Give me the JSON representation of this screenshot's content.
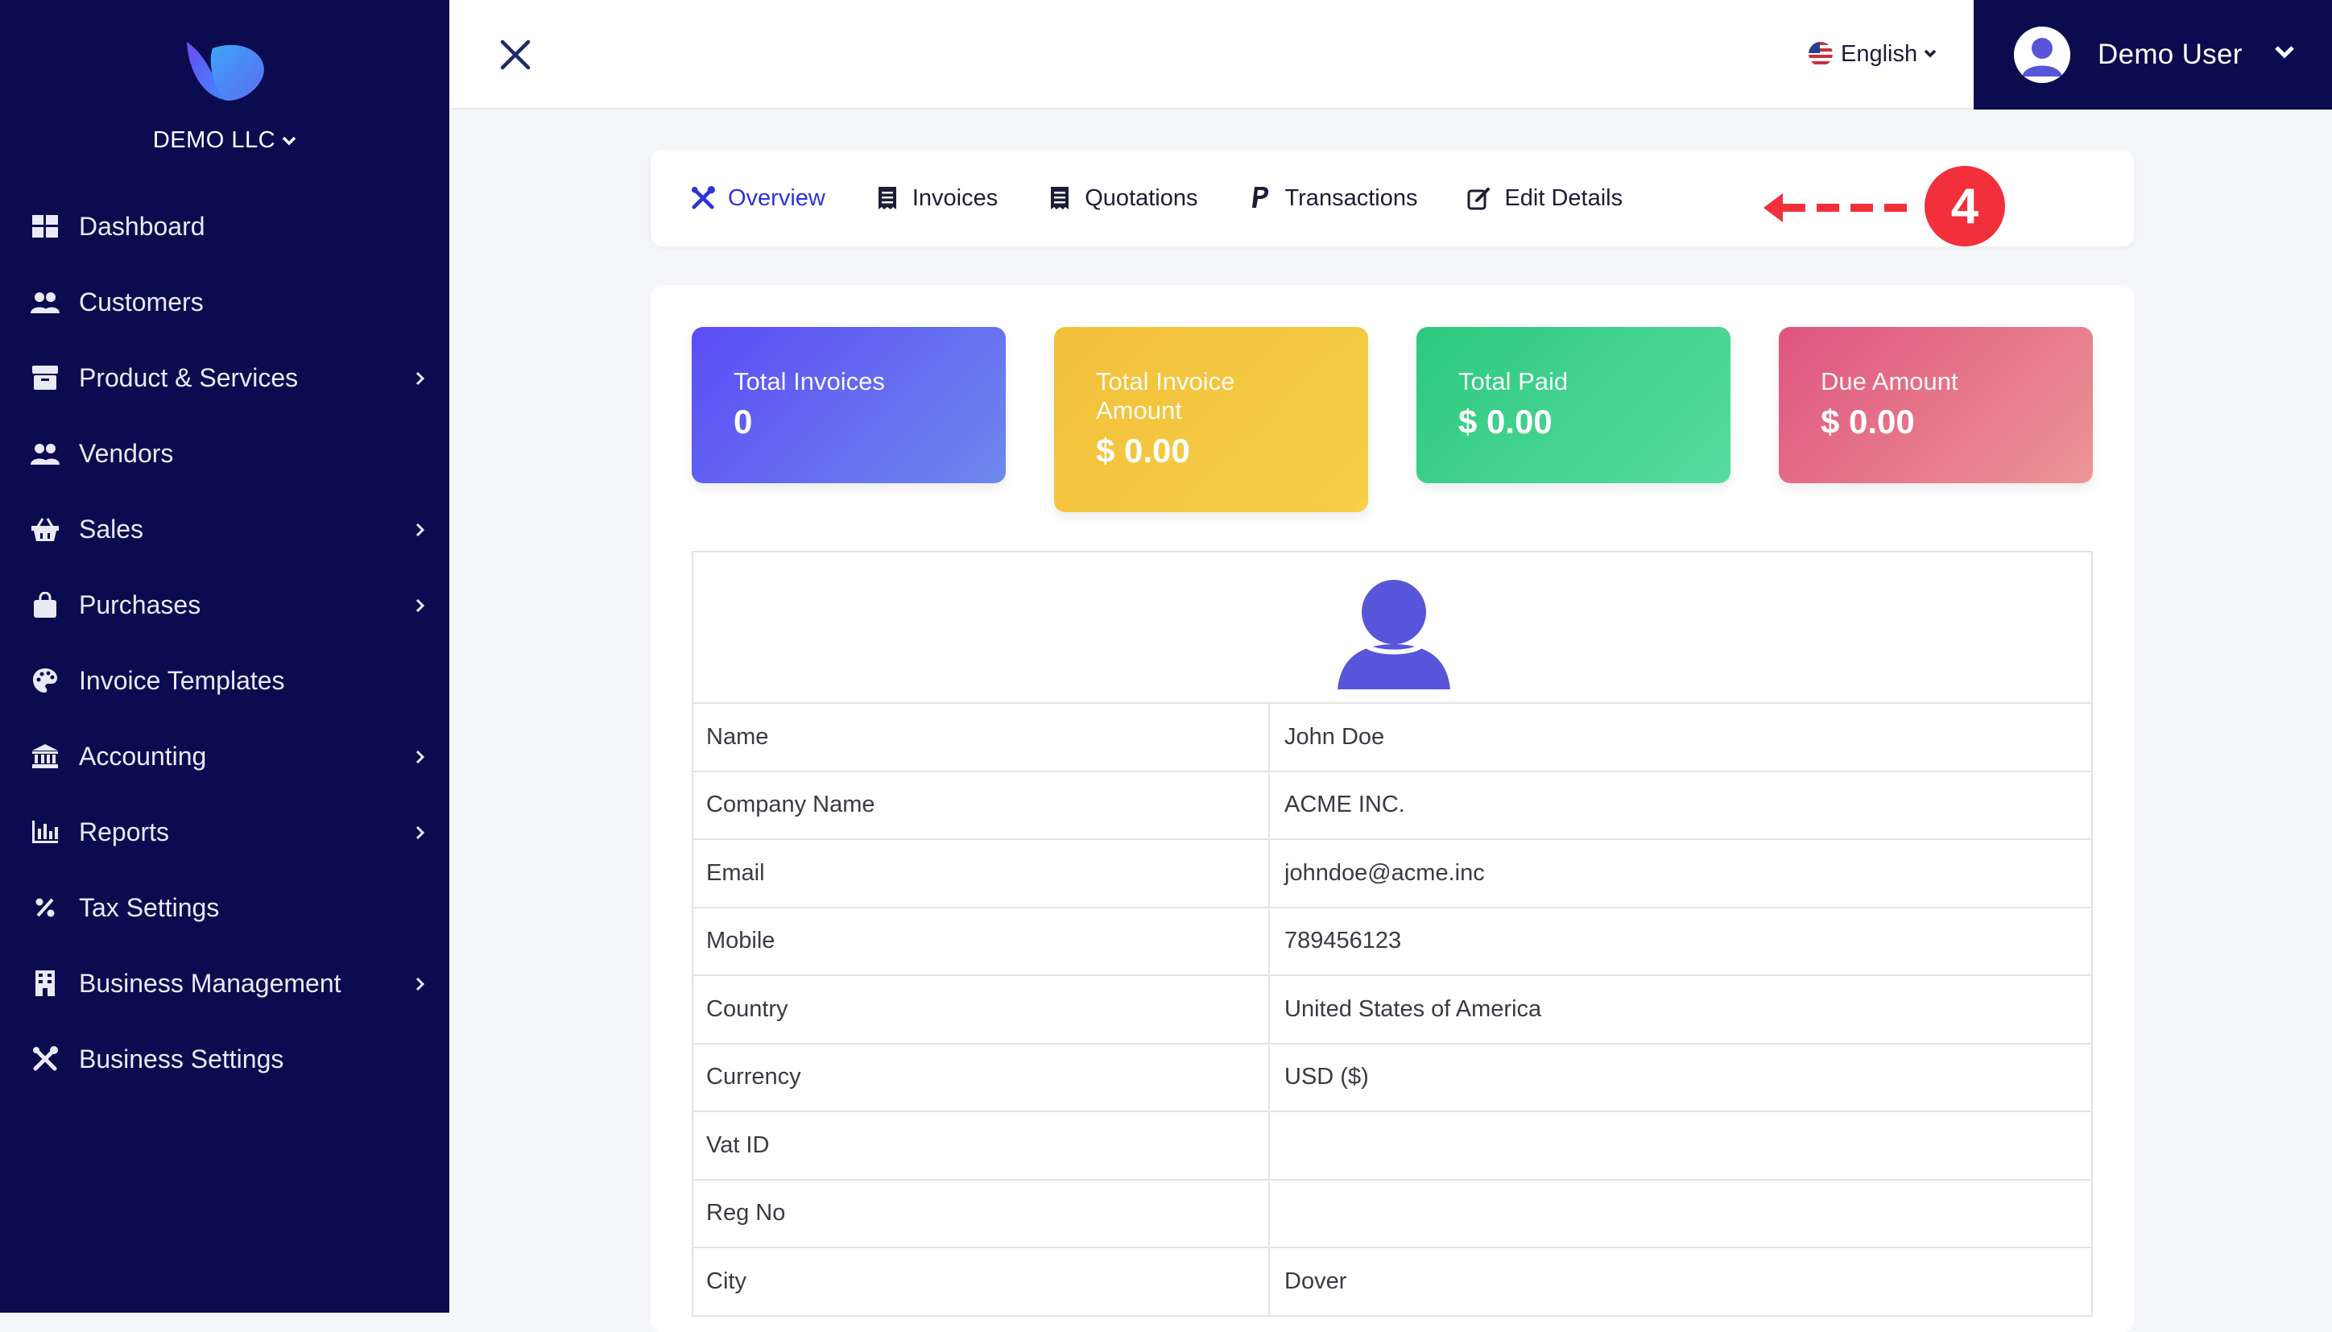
{
  "sidebar": {
    "company": "DEMO LLC",
    "items": [
      {
        "label": "Dashboard",
        "icon": "dashboard-icon"
      },
      {
        "label": "Customers",
        "icon": "users-icon"
      },
      {
        "label": "Product & Services",
        "icon": "box-icon",
        "has_submenu": true
      },
      {
        "label": "Vendors",
        "icon": "users-icon"
      },
      {
        "label": "Sales",
        "icon": "basket-icon",
        "has_submenu": true
      },
      {
        "label": "Purchases",
        "icon": "bag-icon",
        "has_submenu": true
      },
      {
        "label": "Invoice Templates",
        "icon": "palette-icon"
      },
      {
        "label": "Accounting",
        "icon": "bank-icon",
        "has_submenu": true
      },
      {
        "label": "Reports",
        "icon": "chart-icon",
        "has_submenu": true
      },
      {
        "label": "Tax Settings",
        "icon": "percent-icon"
      },
      {
        "label": "Business Management",
        "icon": "building-icon",
        "has_submenu": true
      },
      {
        "label": "Business Settings",
        "icon": "tools-icon"
      }
    ]
  },
  "topbar": {
    "language": "English",
    "user_name": "Demo User"
  },
  "tabs": [
    {
      "label": "Overview",
      "icon": "tools-icon",
      "active": true
    },
    {
      "label": "Invoices",
      "icon": "receipt-icon"
    },
    {
      "label": "Quotations",
      "icon": "receipt-icon"
    },
    {
      "label": "Transactions",
      "icon": "paypal-icon"
    },
    {
      "label": "Edit Details",
      "icon": "edit-icon"
    }
  ],
  "annotation": {
    "number": "4"
  },
  "stats": {
    "total_invoices": {
      "label": "Total Invoices",
      "value": "0"
    },
    "total_invoice_amount": {
      "label": "Total Invoice Amount",
      "value": "$ 0.00"
    },
    "total_paid": {
      "label": "Total Paid",
      "value": "$ 0.00"
    },
    "due_amount": {
      "label": "Due Amount",
      "value": "$ 0.00"
    }
  },
  "details": [
    {
      "key": "Name",
      "value": "John Doe"
    },
    {
      "key": "Company Name",
      "value": "ACME INC."
    },
    {
      "key": "Email",
      "value": "johndoe@acme.inc"
    },
    {
      "key": "Mobile",
      "value": "789456123"
    },
    {
      "key": "Country",
      "value": "United States of America"
    },
    {
      "key": "Currency",
      "value": "USD ($)"
    },
    {
      "key": "Vat ID",
      "value": ""
    },
    {
      "key": "Reg No",
      "value": ""
    },
    {
      "key": "City",
      "value": "Dover"
    }
  ],
  "colors": {
    "sidebar_bg": "#0b0c4f",
    "accent": "#2c33d8",
    "badge": "#f2303b"
  }
}
